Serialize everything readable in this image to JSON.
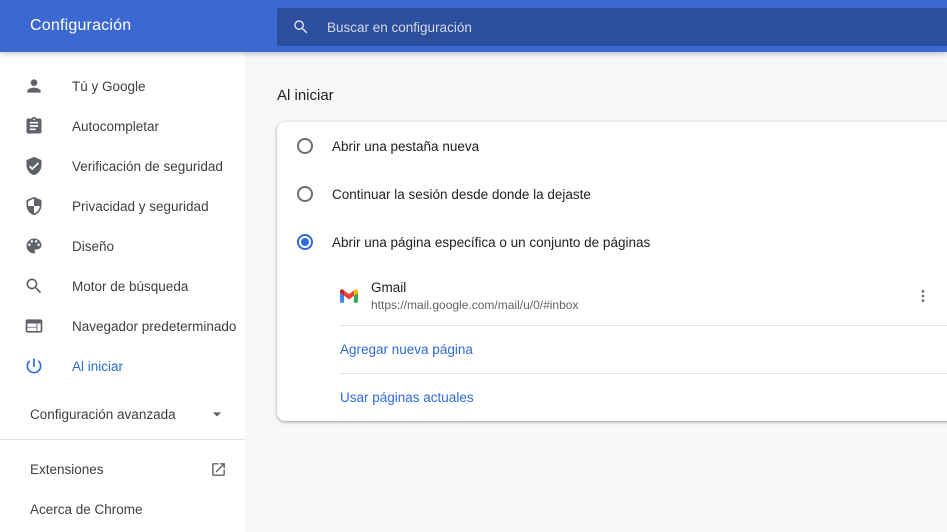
{
  "header": {
    "title": "Configuración",
    "search_placeholder": "Buscar en configuración"
  },
  "sidebar": {
    "items": [
      {
        "label": "Tú y Google",
        "icon": "person-icon",
        "selected": false
      },
      {
        "label": "Autocompletar",
        "icon": "clipboard-icon",
        "selected": false
      },
      {
        "label": "Verificación de seguridad",
        "icon": "shield-check-icon",
        "selected": false
      },
      {
        "label": "Privacidad y seguridad",
        "icon": "shield-half-icon",
        "selected": false
      },
      {
        "label": "Diseño",
        "icon": "palette-icon",
        "selected": false
      },
      {
        "label": "Motor de búsqueda",
        "icon": "magnifier-icon",
        "selected": false
      },
      {
        "label": "Navegador predeterminado",
        "icon": "browser-window-icon",
        "selected": false
      },
      {
        "label": "Al iniciar",
        "icon": "power-icon",
        "selected": true
      }
    ],
    "advanced": {
      "label": "Configuración avanzada",
      "icon": "chevron-down-icon"
    },
    "footer_items": [
      {
        "label": "Extensiones",
        "icon": "open-in-new-icon"
      },
      {
        "label": "Acerca de Chrome"
      }
    ]
  },
  "main": {
    "section_title": "Al iniciar",
    "options": [
      {
        "label": "Abrir una pestaña nueva",
        "selected": false
      },
      {
        "label": "Continuar la sesión desde donde la dejaste",
        "selected": false
      },
      {
        "label": "Abrir una página específica o un conjunto de páginas",
        "selected": true
      }
    ],
    "startup_page": {
      "name": "Gmail",
      "url": "https://mail.google.com/mail/u/0/#inbox",
      "icon": "gmail-icon",
      "menu_icon": "kebab-menu-icon"
    },
    "actions": [
      {
        "label": "Agregar nueva página"
      },
      {
        "label": "Usar páginas actuales"
      }
    ]
  },
  "colors": {
    "header_bg": "#3b69d1",
    "search_bg": "#2f549f",
    "accent_blue": "#2e6bd9",
    "text_primary": "#202124",
    "text_secondary": "#5f6368",
    "content_bg": "#f7f8f9",
    "gmail_red": "#ea4335",
    "gmail_blue": "#4285f4",
    "gmail_green": "#34a853",
    "gmail_yellow": "#fbbc04"
  }
}
